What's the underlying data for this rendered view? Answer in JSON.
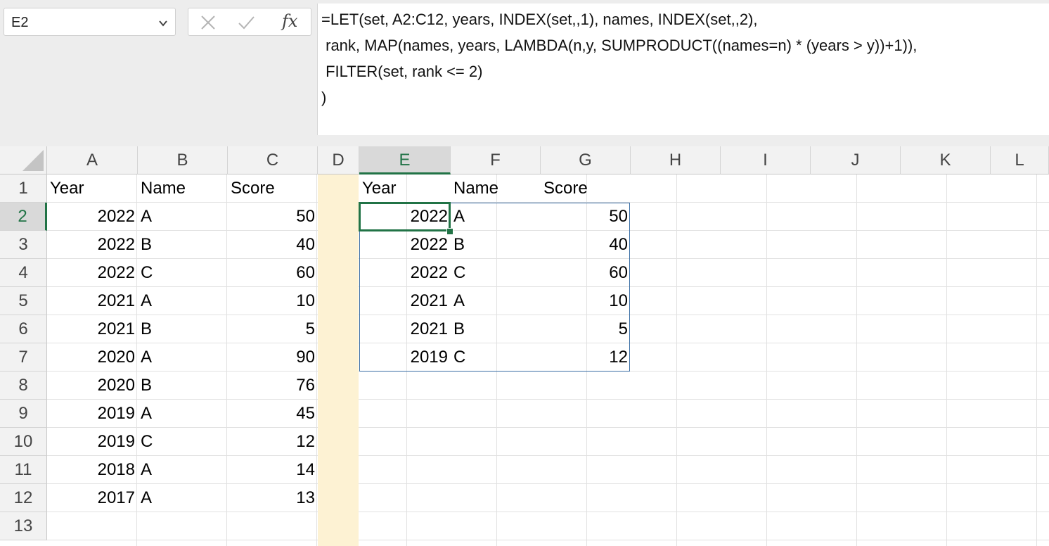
{
  "name_box": {
    "value": "E2"
  },
  "formula_bar": {
    "fx_label": "fx",
    "lines": [
      "=LET(set, A2:C12, years, INDEX(set,,1), names, INDEX(set,,2),",
      " rank, MAP(names, years, LAMBDA(n,y, SUMPRODUCT((names=n) * (years > y))+1)),",
      " FILTER(set, rank <= 2)",
      ")"
    ]
  },
  "columns": [
    "A",
    "B",
    "C",
    "D",
    "E",
    "F",
    "G",
    "H",
    "I",
    "J",
    "K",
    "L"
  ],
  "active_column": "E",
  "rows": [
    "1",
    "2",
    "3",
    "4",
    "5",
    "6",
    "7",
    "8",
    "9",
    "10",
    "11",
    "12",
    "13"
  ],
  "active_row": "2",
  "source_table": {
    "headers": [
      "Year",
      "Name",
      "Score"
    ],
    "rows": [
      [
        "2022",
        "A",
        "50"
      ],
      [
        "2022",
        "B",
        "40"
      ],
      [
        "2022",
        "C",
        "60"
      ],
      [
        "2021",
        "A",
        "10"
      ],
      [
        "2021",
        "B",
        "5"
      ],
      [
        "2020",
        "A",
        "90"
      ],
      [
        "2020",
        "B",
        "76"
      ],
      [
        "2019",
        "A",
        "45"
      ],
      [
        "2019",
        "C",
        "12"
      ],
      [
        "2018",
        "A",
        "14"
      ],
      [
        "2017",
        "A",
        "13"
      ]
    ]
  },
  "result_table": {
    "headers": [
      "Year",
      "Name",
      "Score"
    ],
    "rows": [
      [
        "2022",
        "A",
        "50"
      ],
      [
        "2022",
        "B",
        "40"
      ],
      [
        "2022",
        "C",
        "60"
      ],
      [
        "2021",
        "A",
        "10"
      ],
      [
        "2021",
        "B",
        "5"
      ],
      [
        "2019",
        "C",
        "12"
      ]
    ]
  },
  "colors": {
    "accent_green": "#217346",
    "spill_border": "#3a6ea5",
    "column_d_fill": "#fdf2d3"
  }
}
